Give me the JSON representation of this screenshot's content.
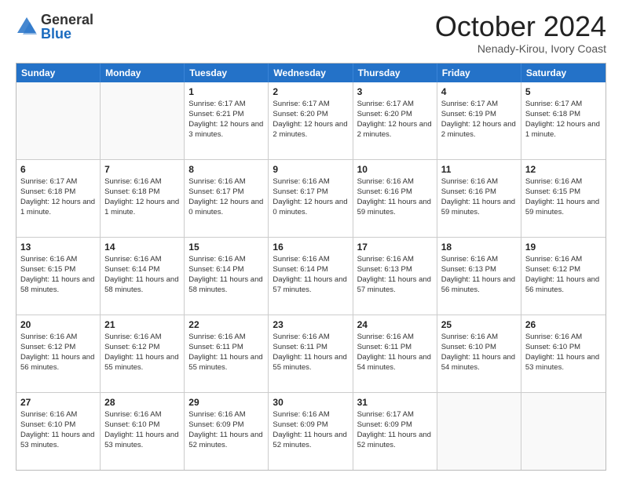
{
  "logo": {
    "general": "General",
    "blue": "Blue"
  },
  "header": {
    "month": "October 2024",
    "location": "Nenady-Kirou, Ivory Coast"
  },
  "weekdays": [
    "Sunday",
    "Monday",
    "Tuesday",
    "Wednesday",
    "Thursday",
    "Friday",
    "Saturday"
  ],
  "weeks": [
    [
      {
        "day": "",
        "sunrise": "",
        "sunset": "",
        "daylight": ""
      },
      {
        "day": "",
        "sunrise": "",
        "sunset": "",
        "daylight": ""
      },
      {
        "day": "1",
        "sunrise": "Sunrise: 6:17 AM",
        "sunset": "Sunset: 6:21 PM",
        "daylight": "Daylight: 12 hours and 3 minutes."
      },
      {
        "day": "2",
        "sunrise": "Sunrise: 6:17 AM",
        "sunset": "Sunset: 6:20 PM",
        "daylight": "Daylight: 12 hours and 2 minutes."
      },
      {
        "day": "3",
        "sunrise": "Sunrise: 6:17 AM",
        "sunset": "Sunset: 6:20 PM",
        "daylight": "Daylight: 12 hours and 2 minutes."
      },
      {
        "day": "4",
        "sunrise": "Sunrise: 6:17 AM",
        "sunset": "Sunset: 6:19 PM",
        "daylight": "Daylight: 12 hours and 2 minutes."
      },
      {
        "day": "5",
        "sunrise": "Sunrise: 6:17 AM",
        "sunset": "Sunset: 6:18 PM",
        "daylight": "Daylight: 12 hours and 1 minute."
      }
    ],
    [
      {
        "day": "6",
        "sunrise": "Sunrise: 6:17 AM",
        "sunset": "Sunset: 6:18 PM",
        "daylight": "Daylight: 12 hours and 1 minute."
      },
      {
        "day": "7",
        "sunrise": "Sunrise: 6:16 AM",
        "sunset": "Sunset: 6:18 PM",
        "daylight": "Daylight: 12 hours and 1 minute."
      },
      {
        "day": "8",
        "sunrise": "Sunrise: 6:16 AM",
        "sunset": "Sunset: 6:17 PM",
        "daylight": "Daylight: 12 hours and 0 minutes."
      },
      {
        "day": "9",
        "sunrise": "Sunrise: 6:16 AM",
        "sunset": "Sunset: 6:17 PM",
        "daylight": "Daylight: 12 hours and 0 minutes."
      },
      {
        "day": "10",
        "sunrise": "Sunrise: 6:16 AM",
        "sunset": "Sunset: 6:16 PM",
        "daylight": "Daylight: 11 hours and 59 minutes."
      },
      {
        "day": "11",
        "sunrise": "Sunrise: 6:16 AM",
        "sunset": "Sunset: 6:16 PM",
        "daylight": "Daylight: 11 hours and 59 minutes."
      },
      {
        "day": "12",
        "sunrise": "Sunrise: 6:16 AM",
        "sunset": "Sunset: 6:15 PM",
        "daylight": "Daylight: 11 hours and 59 minutes."
      }
    ],
    [
      {
        "day": "13",
        "sunrise": "Sunrise: 6:16 AM",
        "sunset": "Sunset: 6:15 PM",
        "daylight": "Daylight: 11 hours and 58 minutes."
      },
      {
        "day": "14",
        "sunrise": "Sunrise: 6:16 AM",
        "sunset": "Sunset: 6:14 PM",
        "daylight": "Daylight: 11 hours and 58 minutes."
      },
      {
        "day": "15",
        "sunrise": "Sunrise: 6:16 AM",
        "sunset": "Sunset: 6:14 PM",
        "daylight": "Daylight: 11 hours and 58 minutes."
      },
      {
        "day": "16",
        "sunrise": "Sunrise: 6:16 AM",
        "sunset": "Sunset: 6:14 PM",
        "daylight": "Daylight: 11 hours and 57 minutes."
      },
      {
        "day": "17",
        "sunrise": "Sunrise: 6:16 AM",
        "sunset": "Sunset: 6:13 PM",
        "daylight": "Daylight: 11 hours and 57 minutes."
      },
      {
        "day": "18",
        "sunrise": "Sunrise: 6:16 AM",
        "sunset": "Sunset: 6:13 PM",
        "daylight": "Daylight: 11 hours and 56 minutes."
      },
      {
        "day": "19",
        "sunrise": "Sunrise: 6:16 AM",
        "sunset": "Sunset: 6:12 PM",
        "daylight": "Daylight: 11 hours and 56 minutes."
      }
    ],
    [
      {
        "day": "20",
        "sunrise": "Sunrise: 6:16 AM",
        "sunset": "Sunset: 6:12 PM",
        "daylight": "Daylight: 11 hours and 56 minutes."
      },
      {
        "day": "21",
        "sunrise": "Sunrise: 6:16 AM",
        "sunset": "Sunset: 6:12 PM",
        "daylight": "Daylight: 11 hours and 55 minutes."
      },
      {
        "day": "22",
        "sunrise": "Sunrise: 6:16 AM",
        "sunset": "Sunset: 6:11 PM",
        "daylight": "Daylight: 11 hours and 55 minutes."
      },
      {
        "day": "23",
        "sunrise": "Sunrise: 6:16 AM",
        "sunset": "Sunset: 6:11 PM",
        "daylight": "Daylight: 11 hours and 55 minutes."
      },
      {
        "day": "24",
        "sunrise": "Sunrise: 6:16 AM",
        "sunset": "Sunset: 6:11 PM",
        "daylight": "Daylight: 11 hours and 54 minutes."
      },
      {
        "day": "25",
        "sunrise": "Sunrise: 6:16 AM",
        "sunset": "Sunset: 6:10 PM",
        "daylight": "Daylight: 11 hours and 54 minutes."
      },
      {
        "day": "26",
        "sunrise": "Sunrise: 6:16 AM",
        "sunset": "Sunset: 6:10 PM",
        "daylight": "Daylight: 11 hours and 53 minutes."
      }
    ],
    [
      {
        "day": "27",
        "sunrise": "Sunrise: 6:16 AM",
        "sunset": "Sunset: 6:10 PM",
        "daylight": "Daylight: 11 hours and 53 minutes."
      },
      {
        "day": "28",
        "sunrise": "Sunrise: 6:16 AM",
        "sunset": "Sunset: 6:10 PM",
        "daylight": "Daylight: 11 hours and 53 minutes."
      },
      {
        "day": "29",
        "sunrise": "Sunrise: 6:16 AM",
        "sunset": "Sunset: 6:09 PM",
        "daylight": "Daylight: 11 hours and 52 minutes."
      },
      {
        "day": "30",
        "sunrise": "Sunrise: 6:16 AM",
        "sunset": "Sunset: 6:09 PM",
        "daylight": "Daylight: 11 hours and 52 minutes."
      },
      {
        "day": "31",
        "sunrise": "Sunrise: 6:17 AM",
        "sunset": "Sunset: 6:09 PM",
        "daylight": "Daylight: 11 hours and 52 minutes."
      },
      {
        "day": "",
        "sunrise": "",
        "sunset": "",
        "daylight": ""
      },
      {
        "day": "",
        "sunrise": "",
        "sunset": "",
        "daylight": ""
      }
    ]
  ]
}
